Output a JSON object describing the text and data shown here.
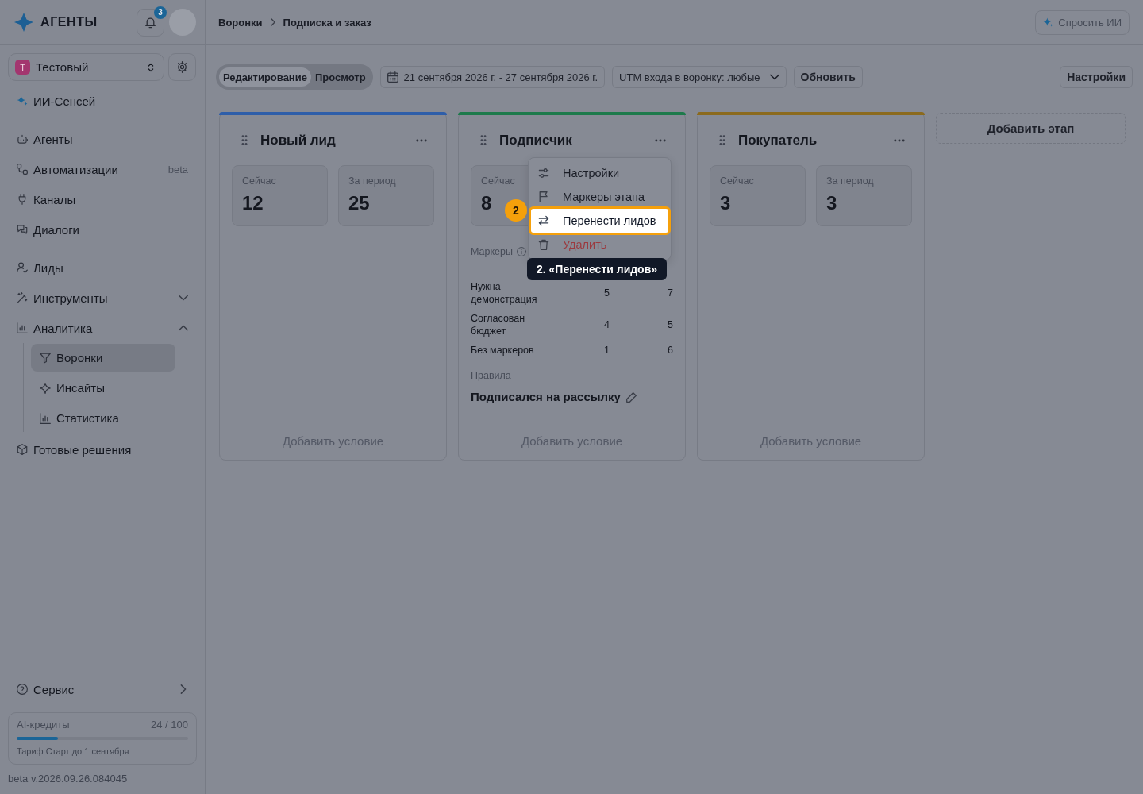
{
  "header": {
    "logo": "АГЕНТЫ",
    "notifications": "3"
  },
  "workspace": {
    "initial": "Т",
    "name": "Тестовый"
  },
  "sidebar": {
    "sections": [
      {
        "items": [
          {
            "label": "ИИ-Сенсей",
            "selected": false
          }
        ]
      },
      {
        "items": [
          {
            "label": "Агенты",
            "selected": false
          },
          {
            "label": "Автоматизации",
            "selected": false,
            "badge": "beta"
          },
          {
            "label": "Каналы",
            "selected": false
          },
          {
            "label": "Диалоги",
            "selected": false
          }
        ]
      },
      {
        "items": [
          {
            "label": "Лиды",
            "selected": false
          },
          {
            "label": "Инструменты",
            "selected": false,
            "expanded": false
          },
          {
            "label": "Аналитика",
            "selected": false,
            "expanded": true,
            "children": [
              {
                "label": "Воронки",
                "selected": true
              },
              {
                "label": "Инсайты",
                "selected": false
              },
              {
                "label": "Статистика",
                "selected": false
              }
            ]
          },
          {
            "label": "Готовые решения",
            "selected": false
          }
        ]
      }
    ],
    "service": "Сервис",
    "credits": {
      "label": "AI-кредиты",
      "reading": "24 / 100",
      "level": 0.24,
      "plan": "Тариф Старт до 1 сентября"
    },
    "version": "beta v.2026.09.26.084045"
  },
  "breadcrumbs": [
    "Воронки",
    "Подписка и заказ"
  ],
  "ask_ai": "Спросить ИИ",
  "toolbar": {
    "modes": [
      {
        "label": "Редактирование",
        "selected": true
      },
      {
        "label": "Просмотр",
        "selected": false
      }
    ],
    "date_range": "21 сентября 2026 г. - 27 сентября 2026 г.",
    "utm_filter": "UTM входа в воронку: любые",
    "refresh": "Обновить",
    "settings": "Настройки"
  },
  "stages": [
    {
      "title": "Новый лид",
      "color": "#2e5ea9",
      "stats": [
        {
          "label": "Сейчас",
          "value": "12"
        },
        {
          "label": "За период",
          "value": "25"
        }
      ],
      "add_condition": "Добавить условие"
    },
    {
      "title": "Подписчик",
      "color": "#1d7a4b",
      "stats": [
        {
          "label": "Сейчас",
          "value": "8"
        }
      ],
      "markers": {
        "title": "Маркеры",
        "rows": [
          {
            "name": "Нужна демонстрация",
            "now": "5",
            "period": "7"
          },
          {
            "name": "Согласован бюджет",
            "now": "4",
            "period": "5"
          },
          {
            "name": "Без маркеров",
            "now": "1",
            "period": "6"
          }
        ]
      },
      "rules": {
        "title": "Правила",
        "items": [
          "Подписался на рассылку"
        ]
      },
      "add_condition": "Добавить условие",
      "menu": {
        "items": [
          {
            "label": "Настройки",
            "kind": "normal",
            "highlighted": false
          },
          {
            "label": "Маркеры этапа",
            "kind": "normal",
            "highlighted": false
          },
          {
            "label": "Перенести лидов",
            "kind": "normal",
            "highlighted": true
          },
          {
            "label": "Удалить",
            "kind": "danger",
            "highlighted": false
          }
        ]
      }
    },
    {
      "title": "Покупатель",
      "color": "#8b6a1d",
      "stats": [
        {
          "label": "Сейчас",
          "value": "3"
        },
        {
          "label": "За период",
          "value": "3"
        }
      ],
      "add_condition": "Добавить условие"
    }
  ],
  "add_stage": "Добавить этап",
  "tour": {
    "step": "2",
    "tooltip": "2. «Перенести лидов»"
  }
}
